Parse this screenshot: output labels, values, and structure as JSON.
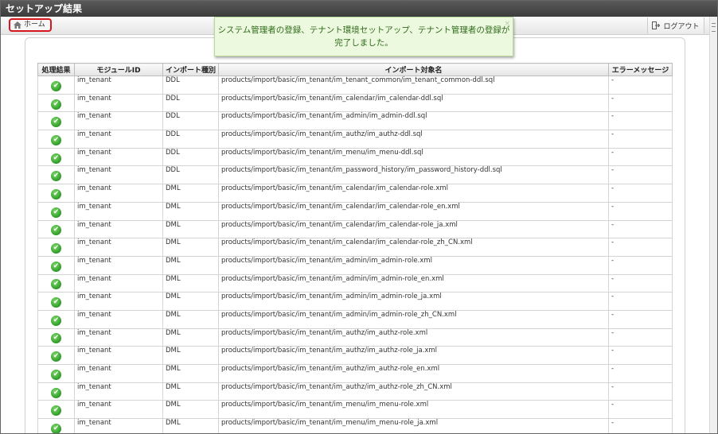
{
  "window": {
    "title": "セットアップ結果"
  },
  "toolbar": {
    "home_label": "ホーム",
    "logout_label": "ログアウト"
  },
  "toast": {
    "message": "システム管理者の登録、テナント環境セットアップ、テナント管理者の登録が完了しました。",
    "close": "×"
  },
  "table": {
    "columns": [
      "処理結果",
      "モジュールID",
      "インポート種別",
      "インポート対象名",
      "エラーメッセージ"
    ],
    "rows": [
      {
        "module": "im_tenant",
        "type": "DDL",
        "target": "products/import/basic/im_tenant/im_tenant_common/im_tenant_common-ddl.sql",
        "error": "-"
      },
      {
        "module": "im_tenant",
        "type": "DDL",
        "target": "products/import/basic/im_tenant/im_calendar/im_calendar-ddl.sql",
        "error": "-"
      },
      {
        "module": "im_tenant",
        "type": "DDL",
        "target": "products/import/basic/im_tenant/im_admin/im_admin-ddl.sql",
        "error": "-"
      },
      {
        "module": "im_tenant",
        "type": "DDL",
        "target": "products/import/basic/im_tenant/im_authz/im_authz-ddl.sql",
        "error": "-"
      },
      {
        "module": "im_tenant",
        "type": "DDL",
        "target": "products/import/basic/im_tenant/im_menu/im_menu-ddl.sql",
        "error": "-"
      },
      {
        "module": "im_tenant",
        "type": "DDL",
        "target": "products/import/basic/im_tenant/im_password_history/im_password_history-ddl.sql",
        "error": "-"
      },
      {
        "module": "im_tenant",
        "type": "DML",
        "target": "products/import/basic/im_tenant/im_calendar/im_calendar-role.xml",
        "error": "-"
      },
      {
        "module": "im_tenant",
        "type": "DML",
        "target": "products/import/basic/im_tenant/im_calendar/im_calendar-role_en.xml",
        "error": "-"
      },
      {
        "module": "im_tenant",
        "type": "DML",
        "target": "products/import/basic/im_tenant/im_calendar/im_calendar-role_ja.xml",
        "error": "-"
      },
      {
        "module": "im_tenant",
        "type": "DML",
        "target": "products/import/basic/im_tenant/im_calendar/im_calendar-role_zh_CN.xml",
        "error": "-"
      },
      {
        "module": "im_tenant",
        "type": "DML",
        "target": "products/import/basic/im_tenant/im_admin/im_admin-role.xml",
        "error": "-"
      },
      {
        "module": "im_tenant",
        "type": "DML",
        "target": "products/import/basic/im_tenant/im_admin/im_admin-role_en.xml",
        "error": "-"
      },
      {
        "module": "im_tenant",
        "type": "DML",
        "target": "products/import/basic/im_tenant/im_admin/im_admin-role_ja.xml",
        "error": "-"
      },
      {
        "module": "im_tenant",
        "type": "DML",
        "target": "products/import/basic/im_tenant/im_admin/im_admin-role_zh_CN.xml",
        "error": "-"
      },
      {
        "module": "im_tenant",
        "type": "DML",
        "target": "products/import/basic/im_tenant/im_authz/im_authz-role.xml",
        "error": "-"
      },
      {
        "module": "im_tenant",
        "type": "DML",
        "target": "products/import/basic/im_tenant/im_authz/im_authz-role_ja.xml",
        "error": "-"
      },
      {
        "module": "im_tenant",
        "type": "DML",
        "target": "products/import/basic/im_tenant/im_authz/im_authz-role_en.xml",
        "error": "-"
      },
      {
        "module": "im_tenant",
        "type": "DML",
        "target": "products/import/basic/im_tenant/im_authz/im_authz-role_zh_CN.xml",
        "error": "-"
      },
      {
        "module": "im_tenant",
        "type": "DML",
        "target": "products/import/basic/im_tenant/im_menu/im_menu-role.xml",
        "error": "-"
      },
      {
        "module": "im_tenant",
        "type": "DML",
        "target": "products/import/basic/im_tenant/im_menu/im_menu-role_ja.xml",
        "error": "-"
      }
    ]
  },
  "icons": {
    "home": "home-icon",
    "logout": "logout-icon",
    "success": "check-circle-icon"
  },
  "colors": {
    "success": "#2e9a27",
    "highlight": "#d6161c",
    "toast_bg": "#edf9df"
  }
}
